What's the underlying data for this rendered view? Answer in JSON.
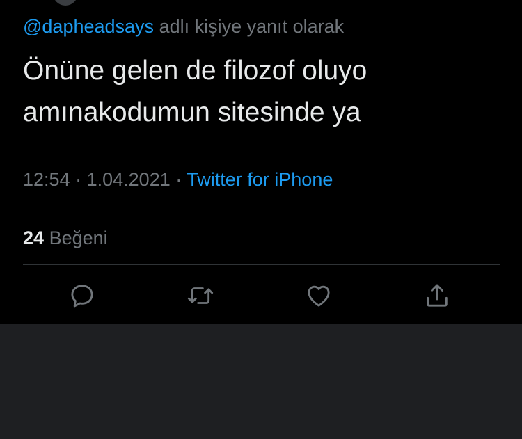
{
  "reply_context": {
    "handle": "@dapheadsays",
    "suffix": "adlı kişiye yanıt olarak"
  },
  "tweet": {
    "line1": "Önüne gelen de filozof oluyo",
    "line2": "amınakodumun sitesinde ya"
  },
  "meta": {
    "time": "12:54",
    "separator1": "·",
    "date": "1.04.2021",
    "separator2": "·",
    "source": "Twitter for iPhone"
  },
  "stats": {
    "likes_count": "24",
    "likes_label": "Beğeni"
  },
  "actions": [
    {
      "icon": "reply-icon"
    },
    {
      "icon": "retweet-icon"
    },
    {
      "icon": "heart-icon"
    },
    {
      "icon": "share-icon"
    }
  ],
  "colors": {
    "background": "#000000",
    "link": "#1d9bf0",
    "text": "#e7e9ea",
    "secondary": "#71767b",
    "divider": "#2f3336",
    "lower_area": "#1e1f22"
  }
}
